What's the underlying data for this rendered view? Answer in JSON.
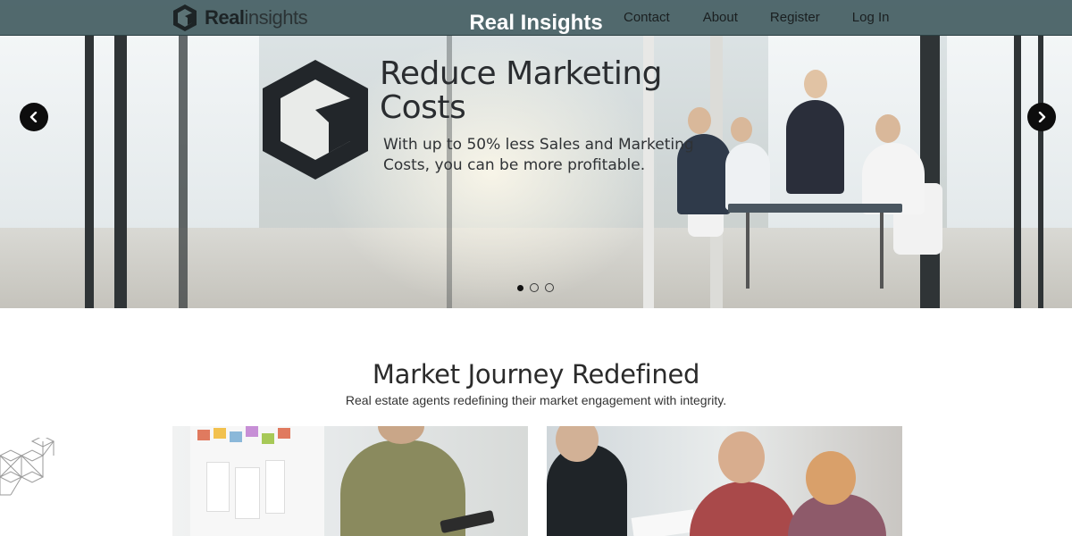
{
  "navbar": {
    "brand_bold": "Real",
    "brand_light": "insights",
    "center_title": "Real Insights",
    "links": [
      {
        "label": "Contact"
      },
      {
        "label": "About"
      },
      {
        "label": "Register"
      },
      {
        "label": "Log In"
      }
    ]
  },
  "hero": {
    "title": "Reduce Marketing Costs",
    "subtitle": "With up to 50% less Sales and Marketing Costs, you can be more profitable.",
    "prev_icon": "chevron-left-icon",
    "next_icon": "chevron-right-icon",
    "slides_total": 3,
    "active_slide": 1
  },
  "section": {
    "title": "Market Journey Redefined",
    "subtitle": "Real estate agents redefining their market engagement with integrity."
  },
  "colors": {
    "navbar_bg": "#3e585c",
    "carousel_button": "#0d0d0d",
    "logo_dark": "#22262a"
  }
}
